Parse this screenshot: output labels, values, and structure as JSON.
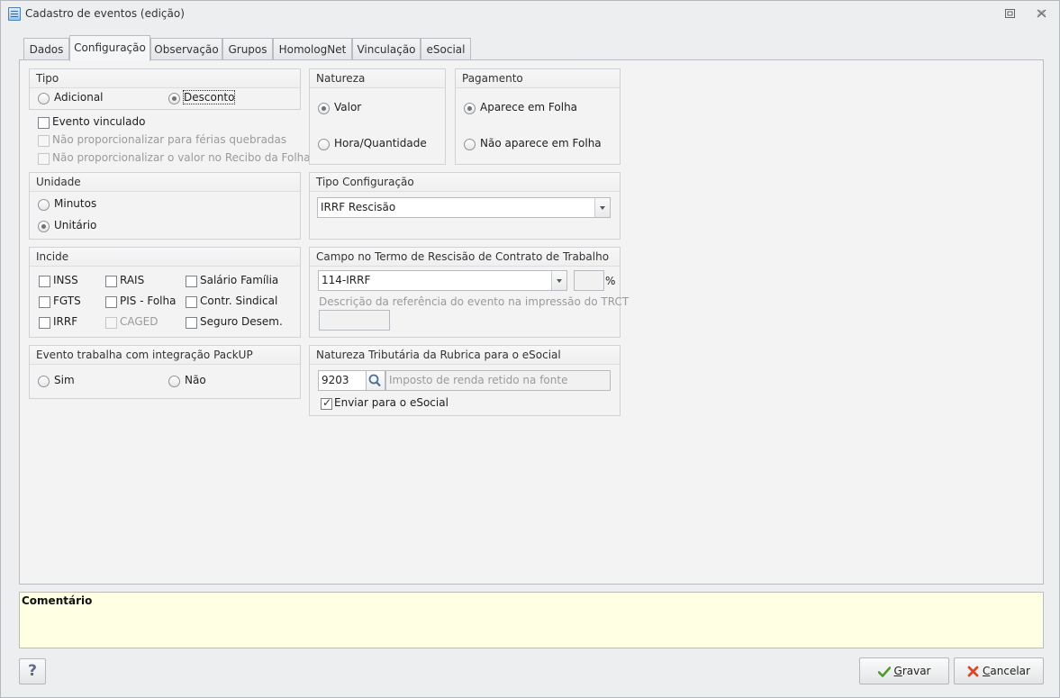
{
  "window": {
    "title": "Cadastro de eventos (edição)",
    "restore_icon": "restore-icon",
    "close_icon": "close-icon"
  },
  "tabs": [
    {
      "label": "Dados"
    },
    {
      "label": "Configuração",
      "active": true
    },
    {
      "label": "Observação"
    },
    {
      "label": "Grupos"
    },
    {
      "label": "HomologNet"
    },
    {
      "label": "Vinculação"
    },
    {
      "label": "eSocial"
    }
  ],
  "tipo": {
    "title": "Tipo",
    "options": [
      "Adicional",
      "Desconto"
    ],
    "selected": "Desconto"
  },
  "checks_tipo": {
    "evento_vinculado": "Evento vinculado",
    "nao_ferias": "Não proporcionalizar para férias quebradas",
    "nao_recibo": "Não proporcionalizar o valor no Recibo da Folha"
  },
  "natureza": {
    "title": "Natureza",
    "options": [
      "Valor",
      "Hora/Quantidade"
    ],
    "selected": "Valor"
  },
  "pagamento": {
    "title": "Pagamento",
    "options": [
      "Aparece em Folha",
      "Não aparece em Folha"
    ],
    "selected": "Aparece em Folha"
  },
  "unidade": {
    "title": "Unidade",
    "options": [
      "Minutos",
      "Unitário"
    ],
    "selected": "Unitário"
  },
  "tipo_config": {
    "title": "Tipo Configuração",
    "value": "IRRF Rescisão"
  },
  "incide": {
    "title": "Incide",
    "items": [
      "INSS",
      "RAIS",
      "Salário Família",
      "FGTS",
      "PIS - Folha",
      "Contr. Sindical",
      "IRRF",
      "CAGED",
      "Seguro Desem."
    ]
  },
  "campo_trct": {
    "title": "Campo no Termo de Rescisão de Contrato de Trabalho",
    "value": "114-IRRF",
    "percent_symbol": "%",
    "desc_label": "Descrição da referência do evento na impressão do TRCT"
  },
  "packup": {
    "title": "Evento trabalha com integração PackUP",
    "options": [
      "Sim",
      "Não"
    ]
  },
  "natureza_trib": {
    "title": "Natureza Tributária da Rubrica para o eSocial",
    "code": "9203",
    "description_placeholder": "Imposto de renda retido na fonte",
    "enviar_label": "Enviar para o eSocial"
  },
  "comment": {
    "label": "Comentário"
  },
  "buttons": {
    "help": "?",
    "gravar_first": "G",
    "gravar_rest": "ravar",
    "cancelar_first": "C",
    "cancelar_rest": "ancelar"
  },
  "icons": {
    "search": "search-icon",
    "check": "checkmark-icon",
    "cross": "cross-icon"
  }
}
